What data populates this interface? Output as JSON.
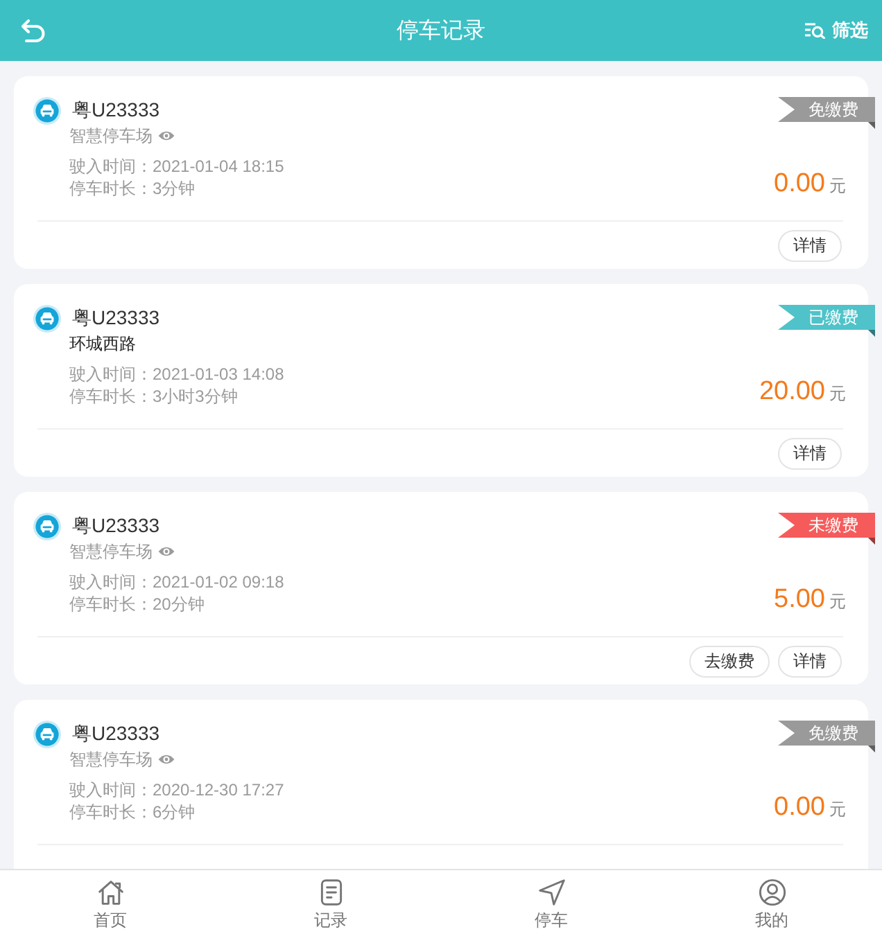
{
  "header": {
    "title": "停车记录",
    "filter_label": "筛选"
  },
  "records": [
    {
      "plate": "粤U23333",
      "location": {
        "kind": "parking_lot",
        "name": "智慧停车场"
      },
      "entry_time": "驶入时间：2021-01-04 18:15",
      "duration": "停车时长：3分钟",
      "status": {
        "label": "免缴费",
        "color": "#9a9a9a"
      },
      "amount": "0.00",
      "currency": "元",
      "buttons": [
        {
          "label": "详情"
        }
      ]
    },
    {
      "plate": "粤U23333",
      "location": {
        "kind": "road",
        "name": "环城西路"
      },
      "entry_time": "驶入时间：2021-01-03 14:08",
      "duration": "停车时长：3小时3分钟",
      "status": {
        "label": "已缴费",
        "color": "#4fc3c9"
      },
      "amount": "20.00",
      "currency": "元",
      "buttons": [
        {
          "label": "详情"
        }
      ]
    },
    {
      "plate": "粤U23333",
      "location": {
        "kind": "parking_lot",
        "name": "智慧停车场"
      },
      "entry_time": "驶入时间：2021-01-02 09:18",
      "duration": "停车时长：20分钟",
      "status": {
        "label": "未缴费",
        "color": "#f65b5b"
      },
      "amount": "5.00",
      "currency": "元",
      "buttons": [
        {
          "label": "去缴费"
        },
        {
          "label": "详情"
        }
      ]
    },
    {
      "plate": "粤U23333",
      "location": {
        "kind": "parking_lot",
        "name": "智慧停车场"
      },
      "entry_time": "驶入时间：2020-12-30 17:27",
      "duration": "停车时长：6分钟",
      "status": {
        "label": "免缴费",
        "color": "#9a9a9a"
      },
      "amount": "0.00",
      "currency": "元"
    }
  ],
  "tab_bar": [
    {
      "label": "首页",
      "selected": false
    },
    {
      "label": "记录",
      "selected": false
    },
    {
      "label": "停车",
      "selected": false
    },
    {
      "label": "我的",
      "selected": false
    }
  ]
}
